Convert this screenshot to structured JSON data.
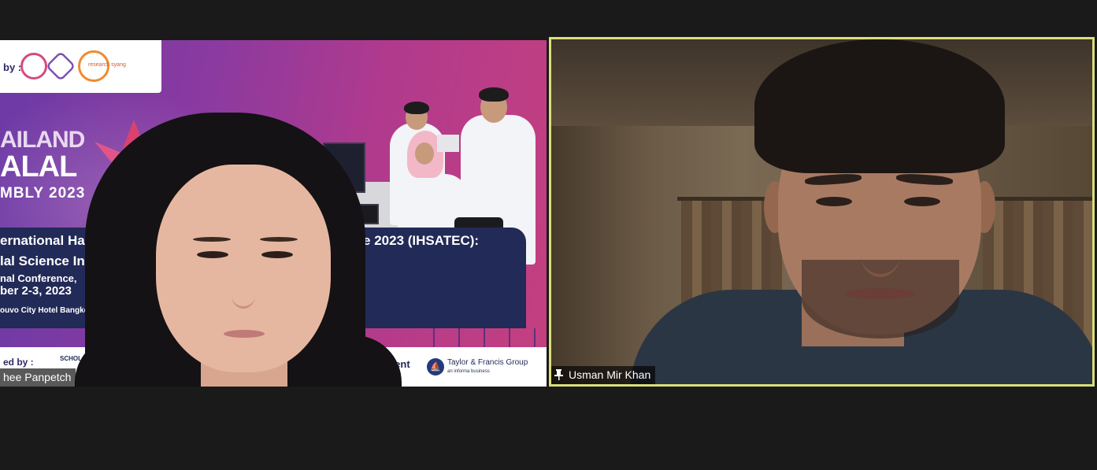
{
  "meeting": {
    "participants": [
      {
        "name": "hee Panpetch"
      },
      {
        "name": "Usman Mir Khan"
      }
    ],
    "active_speaker_border_color": "#d9e07a"
  },
  "banner": {
    "by_label": "by :",
    "org_text": "research syang",
    "brand_line1": "AILAND",
    "brand_line2": "ALAL",
    "brand_line3": "MBLY 2023",
    "conf_title_left": "ernational Halal Sci",
    "conf_title_right": "ference 2023 (IHSATEC):",
    "conf_subtitle": "lal Science Industr",
    "conf_type": "nal Conference,",
    "conf_dates": "ber 2-3, 2023",
    "conf_venue": "ouvo City Hotel Bangkok, Thaila",
    "sponsor_by_label": "ed by :",
    "sponsor_scholar": "SCHOLAR",
    "sponsor_agent": "agent",
    "sponsor_tf_name": "Taylor & Francis Group",
    "sponsor_tf_sub": "an informa business",
    "colors": {
      "gradient_start": "#6b3aa6",
      "gradient_end": "#c4407f",
      "panel": "#222a57"
    }
  },
  "icons": {
    "pin": "pin-icon"
  }
}
